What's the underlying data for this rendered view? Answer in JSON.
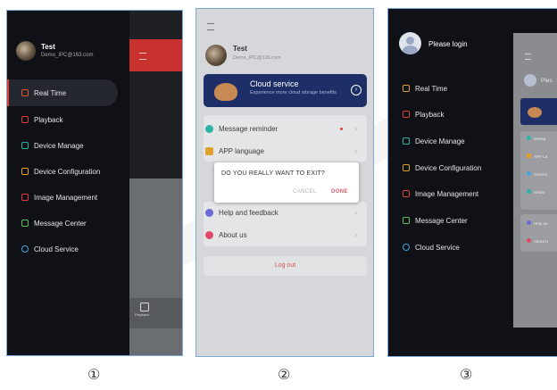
{
  "screen1": {
    "user": {
      "name": "Test",
      "email": "Demo_IPC@163.com"
    },
    "menu": [
      {
        "label": "Real Time",
        "icon": "real-time-icon",
        "color": "#e05a2b"
      },
      {
        "label": "Playback",
        "icon": "playback-icon",
        "color": "#e03b3b"
      },
      {
        "label": "Device Manage",
        "icon": "device-manage-icon",
        "color": "#2bb3a3"
      },
      {
        "label": "Device Configuration",
        "icon": "device-config-icon",
        "color": "#e0a02b"
      },
      {
        "label": "Image Management",
        "icon": "image-management-icon",
        "color": "#e03b3b"
      },
      {
        "label": "Message Center",
        "icon": "message-center-icon",
        "color": "#5ac05a"
      },
      {
        "label": "Cloud Service",
        "icon": "cloud-service-icon",
        "color": "#4aa3e0"
      }
    ],
    "side_label": "Playback"
  },
  "screen2": {
    "user": {
      "name": "Test",
      "email": "Demo_IPC@126.com"
    },
    "banner": {
      "title": "Cloud service",
      "subtitle": "Experience more cloud storage benefits"
    },
    "settings": [
      {
        "label": "Message reminder",
        "color": "#2bb3a3"
      },
      {
        "label": "APP language",
        "color": "#e0a02b"
      },
      {
        "label": "Help and feedback",
        "color": "#6a6ad8"
      },
      {
        "label": "About us",
        "color": "#e04a6a"
      }
    ],
    "dialog": {
      "message": "DO YOU REALLY WANT TO EXIT?",
      "cancel": "CANCEL",
      "done": "DONE"
    },
    "logout": "Log out"
  },
  "screen3": {
    "login": "Please login",
    "menu": [
      {
        "label": "Real Time",
        "icon": "real-time-icon",
        "color": "#e0a02b"
      },
      {
        "label": "Playback",
        "icon": "playback-icon",
        "color": "#e03b3b"
      },
      {
        "label": "Device Manage",
        "icon": "device-manage-icon",
        "color": "#2bb3a3"
      },
      {
        "label": "Device Configuration",
        "icon": "device-config-icon",
        "color": "#e0a02b"
      },
      {
        "label": "Image Management",
        "icon": "image-management-icon",
        "color": "#e03b3b"
      },
      {
        "label": "Message Center",
        "icon": "message-center-icon",
        "color": "#5ac05a"
      },
      {
        "label": "Cloud Service",
        "icon": "cloud-service-icon",
        "color": "#4aa3e0"
      }
    ],
    "peek": {
      "login_partial": "Ples",
      "rows": [
        "Messa",
        "APP La",
        "Genera",
        "Share",
        "Help an",
        "About U"
      ]
    }
  },
  "captions": [
    "①",
    "②",
    "③"
  ],
  "colors": {
    "accent": "#e03b3b",
    "frame": "#7aa8d8"
  }
}
